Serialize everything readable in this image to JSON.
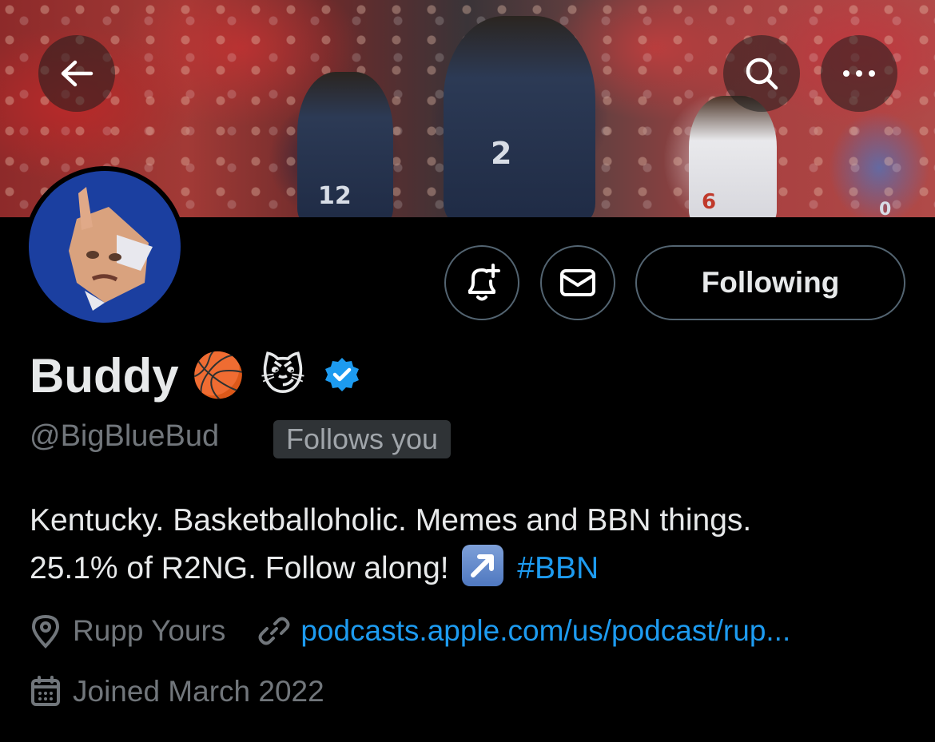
{
  "header": {
    "back_icon": "arrow-left-icon",
    "search_icon": "search-icon",
    "more_icon": "more-horizontal-icon"
  },
  "banner": {
    "jersey_numbers": [
      "12",
      "2",
      "6",
      "0"
    ]
  },
  "actions": {
    "notify_icon": "bell-plus-icon",
    "message_icon": "mail-icon",
    "following_label": "Following"
  },
  "profile": {
    "display_name": "Buddy",
    "name_emojis": "🏀 😼",
    "verified": true,
    "handle": "@BigBlueBud",
    "follows_you": "Follows you",
    "bio_line1": "Kentucky. Basketballoholic. Memes and BBN things.",
    "bio_line2_text": "25.1% of R2NG. Follow along!",
    "bio_hashtag": "#BBN",
    "location": "Rupp Yours",
    "website": "podcasts.apple.com/us/podcast/rup...",
    "joined": "Joined March 2022"
  },
  "colors": {
    "accent": "#1d9bf0",
    "muted": "#71767b",
    "avatar_bg": "#1b3fa0"
  }
}
